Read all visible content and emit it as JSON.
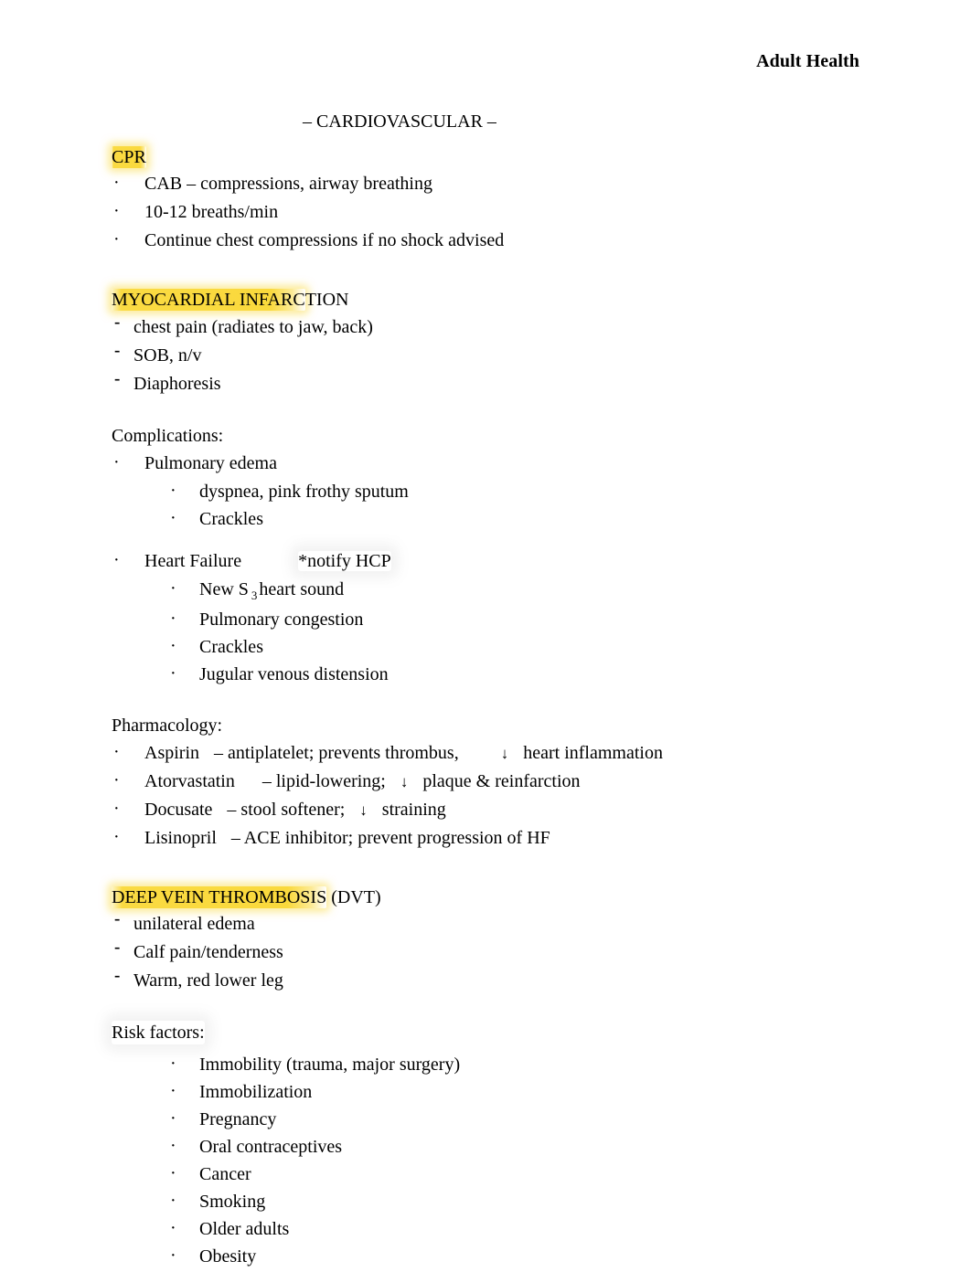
{
  "header": {
    "running_title": "Adult Health"
  },
  "document": {
    "title": "– CARDIOVASCULAR –"
  },
  "sections": [
    {
      "id": "cpr",
      "heading_highlighted": "CPR",
      "heading_tail": "",
      "items": [
        "CAB – compressions, airway breathing",
        "10-12 breaths/min",
        "Continue chest compressions if no shock advised"
      ]
    },
    {
      "id": "myocardial-infarction",
      "heading_highlighted": "MYOCARDIAL INFARC",
      "heading_tail": "TION",
      "items": [
        "chest pain (radiates to jaw, back)",
        "SOB, n/v",
        "Diaphoresis"
      ],
      "complications": {
        "lead": "Complications:",
        "groups": [
          {
            "label": "Pulmonary edema",
            "note": "",
            "sub": [
              "dyspnea, pink frothy sputum",
              "Crackles"
            ]
          },
          {
            "label": "Heart Failure",
            "note": "*notify HCP",
            "sub_prefix": "New S",
            "sub_subscript": "3",
            "sub_suffix": "heart sound",
            "sub": [
              "Pulmonary congestion",
              "Crackles",
              "Jugular venous distension"
            ]
          }
        ]
      },
      "pharmacology": {
        "lead": "Pharmacology:",
        "drugs": [
          {
            "name": "Aspirin",
            "dash": "–",
            "effect": "antiplatelet; prevents thrombus,",
            "arrow": "↓",
            "arrow_effect": "heart inflammation"
          },
          {
            "name": "Atorvastatin",
            "dash": "–",
            "effect": "lipid-lowering;",
            "arrow": "↓",
            "arrow_effect": "plaque & reinfarction"
          },
          {
            "name": "Docusate",
            "dash": "–",
            "effect": "stool softener;",
            "arrow": "↓",
            "arrow_effect": "straining"
          },
          {
            "name": "Lisinopril",
            "dash": "–",
            "effect": "ACE inhibitor; prevent progression of HF",
            "arrow": "",
            "arrow_effect": ""
          }
        ]
      }
    },
    {
      "id": "deep-vein-thrombosis",
      "heading_highlighted": "DEEP VEIN THROMBOSIS",
      "heading_tail": " (DVT)",
      "items": [
        "unilateral edema",
        "Calf pain/tenderness",
        "Warm, red lower leg"
      ],
      "risk_factors": {
        "lead": "Risk factors:",
        "items": [
          "Immobility (trauma, major surgery)",
          "Immobilization",
          "Pregnancy",
          "Oral contraceptives",
          "Cancer",
          "Smoking",
          "Older adults",
          "Obesity"
        ]
      }
    }
  ],
  "colors": {
    "highlight": "#FAD93C",
    "text": "#000000",
    "page": "#FFFFFF"
  }
}
